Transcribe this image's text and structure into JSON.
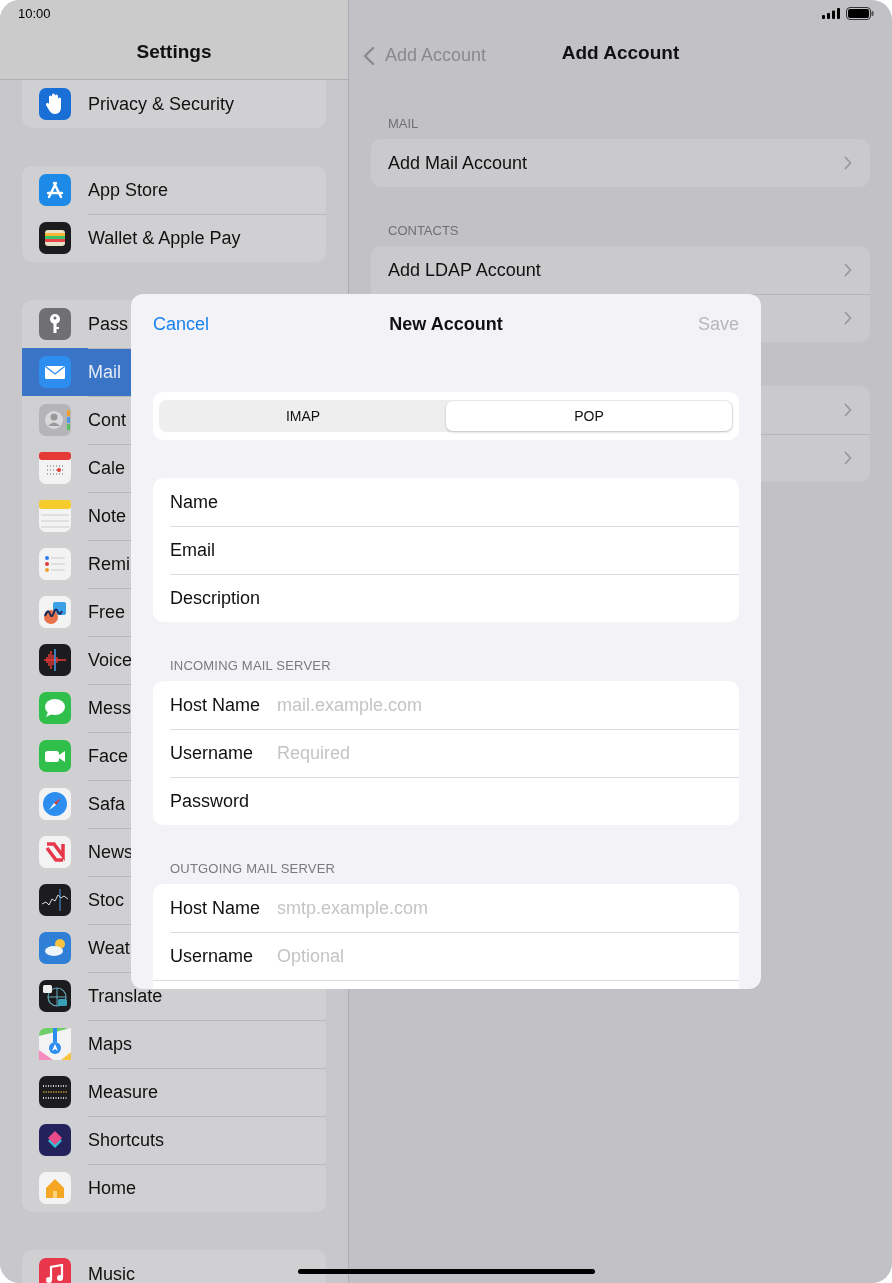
{
  "status_bar": {
    "time": "10:00"
  },
  "sidebar": {
    "title": "Settings",
    "groups": [
      {
        "items": [
          {
            "label": "Privacy & Security",
            "kind": "privacy",
            "selected": false
          }
        ]
      },
      {
        "items": [
          {
            "label": "App Store",
            "kind": "appstore",
            "selected": false
          },
          {
            "label": "Wallet & Apple Pay",
            "kind": "wallet",
            "selected": false
          }
        ]
      },
      {
        "items": [
          {
            "label": "Pass",
            "kind": "key",
            "selected": false
          },
          {
            "label": "Mail",
            "kind": "mail",
            "selected": true
          },
          {
            "label": "Cont",
            "kind": "contacts",
            "selected": false
          },
          {
            "label": "Cale",
            "kind": "calendar",
            "selected": false
          },
          {
            "label": "Note",
            "kind": "notes",
            "selected": false
          },
          {
            "label": "Remi",
            "kind": "reminders",
            "selected": false
          },
          {
            "label": "Free",
            "kind": "freeform",
            "selected": false
          },
          {
            "label": "Voice",
            "kind": "voice",
            "selected": false
          },
          {
            "label": "Mess",
            "kind": "messages",
            "selected": false
          },
          {
            "label": "Face",
            "kind": "facetime",
            "selected": false
          },
          {
            "label": "Safa",
            "kind": "safari",
            "selected": false
          },
          {
            "label": "News",
            "kind": "news",
            "selected": false
          },
          {
            "label": "Stoc",
            "kind": "stocks",
            "selected": false
          },
          {
            "label": "Weat",
            "kind": "weather",
            "selected": false
          },
          {
            "label": "Translate",
            "kind": "translate",
            "selected": false
          },
          {
            "label": "Maps",
            "kind": "maps",
            "selected": false
          },
          {
            "label": "Measure",
            "kind": "measure",
            "selected": false
          },
          {
            "label": "Shortcuts",
            "kind": "shortcuts",
            "selected": false
          },
          {
            "label": "Home",
            "kind": "home",
            "selected": false
          }
        ]
      },
      {
        "items": [
          {
            "label": "Music",
            "kind": "music",
            "selected": false
          }
        ]
      }
    ]
  },
  "detail": {
    "back": "Add Account",
    "title": "Add Account",
    "sections": [
      {
        "header": "MAIL",
        "rows": [
          {
            "kind": "labeled",
            "label": "Add Mail Account"
          }
        ]
      },
      {
        "header": "CONTACTS",
        "rows": [
          {
            "kind": "labeled",
            "label": "Add LDAP Account"
          },
          {
            "kind": "covered"
          }
        ]
      },
      {
        "rows": [
          {
            "kind": "covered"
          },
          {
            "kind": "covered"
          }
        ]
      }
    ]
  },
  "modal": {
    "cancel": "Cancel",
    "title": "New Account",
    "save": "Save",
    "save_disabled": true,
    "segments": [
      {
        "label": "IMAP",
        "selected": false
      },
      {
        "label": "POP",
        "selected": true
      }
    ],
    "groups": [
      {
        "fields": [
          {
            "label": "Name"
          },
          {
            "label": "Email"
          },
          {
            "label": "Description"
          }
        ]
      },
      {
        "header": "INCOMING MAIL SERVER",
        "fields": [
          {
            "label": "Host Name",
            "placeholder": "mail.example.com"
          },
          {
            "label": "Username",
            "placeholder": "Required"
          },
          {
            "label": "Password"
          }
        ]
      },
      {
        "header": "OUTGOING MAIL SERVER",
        "continues": true,
        "fields": [
          {
            "label": "Host Name",
            "placeholder": "smtp.example.com"
          },
          {
            "label": "Username",
            "placeholder": "Optional"
          }
        ]
      }
    ]
  }
}
